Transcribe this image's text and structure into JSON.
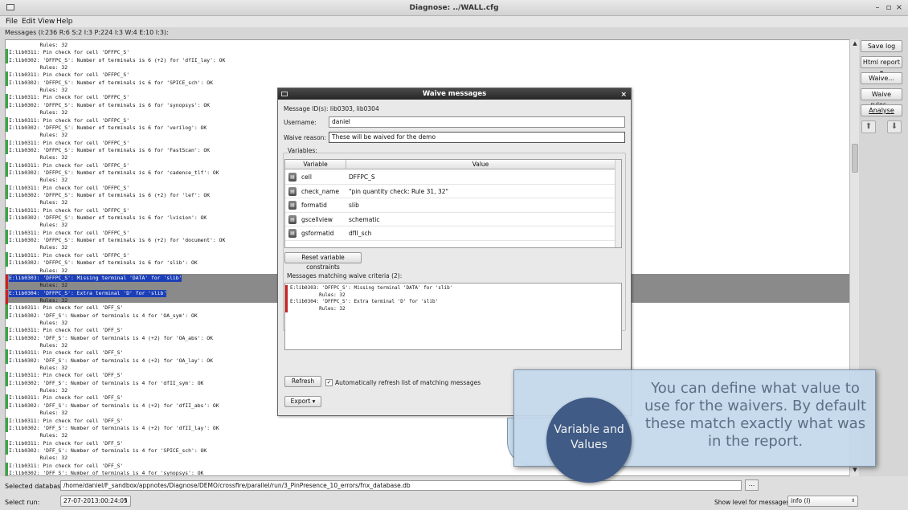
{
  "window": {
    "title": "Diagnose: ../WALL.cfg",
    "minimize": "–",
    "maximize": "▫",
    "close": "×"
  },
  "menu": {
    "file": "File",
    "edit": "Edit",
    "view": "View",
    "help": "Help"
  },
  "messages_header": "Messages (I:236 R:6 S:2 I:3 P:224 I:3 W:4 E:10 I:3):",
  "log_lines": [
    "          Rules: 32",
    "I:lib0311: Pin check for cell 'DFFPC_S'",
    "I:lib0302: 'DFFPC_S': Number of terminals is 6 (+2) for 'dfII_lay': OK",
    "          Rules: 32",
    "I:lib0311: Pin check for cell 'DFFPC_S'",
    "I:lib0302: 'DFFPC_S': Number of terminals is 6 for 'SPICE_sch': OK",
    "          Rules: 32",
    "I:lib0311: Pin check for cell 'DFFPC_S'",
    "I:lib0302: 'DFFPC_S': Number of terminals is 6 for 'synopsys': OK",
    "          Rules: 32",
    "I:lib0311: Pin check for cell 'DFFPC_S'",
    "I:lib0302: 'DFFPC_S': Number of terminals is 6 for 'verilog': OK",
    "          Rules: 32",
    "I:lib0311: Pin check for cell 'DFFPC_S'",
    "I:lib0302: 'DFFPC_S': Number of terminals is 6 for 'FastScan': OK",
    "          Rules: 32",
    "I:lib0311: Pin check for cell 'DFFPC_S'",
    "I:lib0302: 'DFFPC_S': Number of terminals is 6 for 'cadence_tlf': OK",
    "          Rules: 32",
    "I:lib0311: Pin check for cell 'DFFPC_S'",
    "I:lib0302: 'DFFPC_S': Number of terminals is 6 (+2) for 'lef': OK",
    "          Rules: 32",
    "I:lib0311: Pin check for cell 'DFFPC_S'",
    "I:lib0302: 'DFFPC_S': Number of terminals is 6 for 'lvision': OK",
    "          Rules: 32",
    "I:lib0311: Pin check for cell 'DFFPC_S'",
    "I:lib0302: 'DFFPC_S': Number of terminals is 6 (+2) for 'document': OK",
    "          Rules: 32",
    "I:lib0311: Pin check for cell 'DFFPC_S'",
    "I:lib0302: 'DFFPC_S': Number of terminals is 6 for 'slib': OK",
    "          Rules: 32",
    "E:lib0303: 'DFFPC_S': Missing terminal 'DATA' for 'slib'",
    "          Rules: 32",
    "E:lib0304: 'DFFPC_S': Extra terminal 'D' for 'slib'",
    "          Rules: 32",
    "I:lib0311: Pin check for cell 'DFF_S'",
    "I:lib0302: 'DFF_S': Number of terminals is 4 for 'OA_sym': OK",
    "          Rules: 32",
    "I:lib0311: Pin check for cell 'DFF_S'",
    "I:lib0302: 'DFF_S': Number of terminals is 4 (+2) for 'OA_abs': OK",
    "          Rules: 32",
    "I:lib0311: Pin check for cell 'DFF_S'",
    "I:lib0302: 'DFF_S': Number of terminals is 4 (+2) for 'OA_lay': OK",
    "          Rules: 32",
    "I:lib0311: Pin check for cell 'DFF_S'",
    "I:lib0302: 'DFF_S': Number of terminals is 4 for 'dfII_sym': OK",
    "          Rules: 32",
    "I:lib0311: Pin check for cell 'DFF_S'",
    "I:lib0302: 'DFF_S': Number of terminals is 4 (+2) for 'dfII_abs': OK",
    "          Rules: 32",
    "I:lib0311: Pin check for cell 'DFF_S'",
    "I:lib0302: 'DFF_S': Number of terminals is 4 (+2) for 'dfII_lay': OK",
    "          Rules: 32",
    "I:lib0311: Pin check for cell 'DFF_S'",
    "I:lib0302: 'DFF_S': Number of terminals is 4 for 'SPICE_sch': OK",
    "          Rules: 32",
    "I:lib0311: Pin check for cell 'DFF_S'",
    "I:lib0302: 'DFF_S': Number of terminals is 4 for 'synopsys': OK"
  ],
  "side_buttons": {
    "save_log": "Save log",
    "html_report": "Html report ▾",
    "waive": "Waive...",
    "waive_rules": "Waive rules...",
    "analyse": "Analyse"
  },
  "bottom": {
    "db_label": "Selected database:",
    "db_path": "/home/daniel/F_sandbox/appnotes/Diagnose/DEMO/crossfire/parallel/run/3_PinPresence_10_errors/fnx_database.db",
    "browse": "...",
    "run_label": "Select run:",
    "run_value": "27-07-2013:00:24:05",
    "level_label": "Show level for messages:",
    "level_value": "info (I)"
  },
  "dialog": {
    "title": "Waive messages",
    "message_ids": "Message ID(s): lib0303, lib0304",
    "username_label": "Username:",
    "username_value": "daniel",
    "reason_label": "Waive reason:",
    "reason_value": "These will be waived for the demo",
    "variables_label": "Variables:",
    "col_variable": "Variable",
    "col_value": "Value",
    "variables": [
      {
        "name": "cell",
        "value": "DFFPC_S"
      },
      {
        "name": "check_name",
        "value": "\"pin quantity check: Rule 31, 32\""
      },
      {
        "name": "formatid",
        "value": "slib"
      },
      {
        "name": "gscellview",
        "value": "schematic"
      },
      {
        "name": "gsformatid",
        "value": "dfII_sch"
      }
    ],
    "reset_button": "Reset variable constraints",
    "matching_label": "Messages matching waive criteria (2):",
    "matching_lines": [
      "E:lib0303: 'DFFPC_S': Missing terminal 'DATA' for 'slib'",
      "          Rules: 32",
      "E:lib0304: 'DFFPC_S': Extra terminal 'D' for 'slib'",
      "          Rules: 32"
    ],
    "refresh_button": "Refresh",
    "auto_refresh_label": "Automatically refresh list of matching messages",
    "export_button": "Export ▾"
  },
  "callout": {
    "bubble": "Variable and Values",
    "text": "You can define what value to use for the waivers.  By default these match exactly what was in the report."
  }
}
